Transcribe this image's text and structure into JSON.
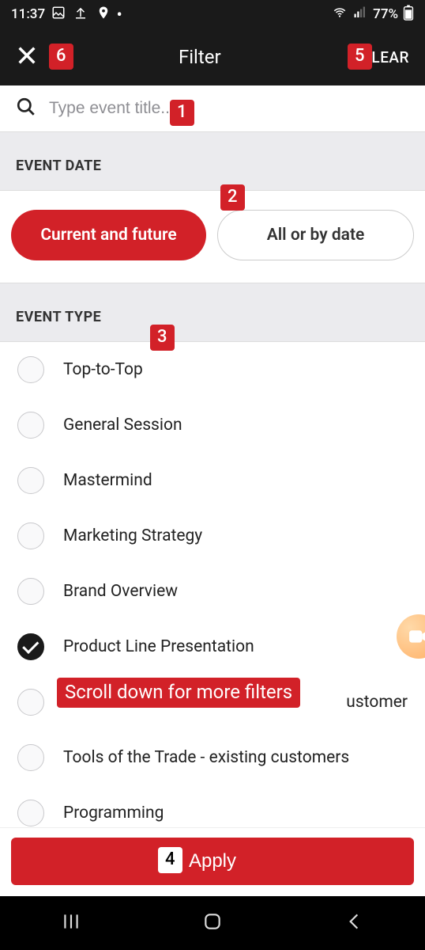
{
  "status": {
    "time": "11:37",
    "battery": "77%"
  },
  "header": {
    "title": "Filter",
    "clear": "CLEAR"
  },
  "search": {
    "placeholder": "Type event title..."
  },
  "sections": {
    "event_date": "EVENT DATE",
    "event_type": "EVENT TYPE"
  },
  "date_chips": {
    "current": "Current and future",
    "all": "All or by date"
  },
  "event_types": [
    {
      "label": "Top-to-Top",
      "checked": false
    },
    {
      "label": "General Session",
      "checked": false
    },
    {
      "label": "Mastermind",
      "checked": false
    },
    {
      "label": "Marketing Strategy",
      "checked": false
    },
    {
      "label": "Brand Overview",
      "checked": false
    },
    {
      "label": "Product Line Presentation",
      "checked": true
    },
    {
      "label": "ustomer",
      "checked": false
    },
    {
      "label": "Tools of the Trade - existing customers",
      "checked": false
    },
    {
      "label": "Programming",
      "checked": false
    }
  ],
  "apply_label": "Apply",
  "badges": {
    "b1": "1",
    "b2": "2",
    "b3": "3",
    "b4": "4",
    "b5": "5",
    "b6": "6"
  },
  "scroll_hint": "Scroll down for more filters"
}
